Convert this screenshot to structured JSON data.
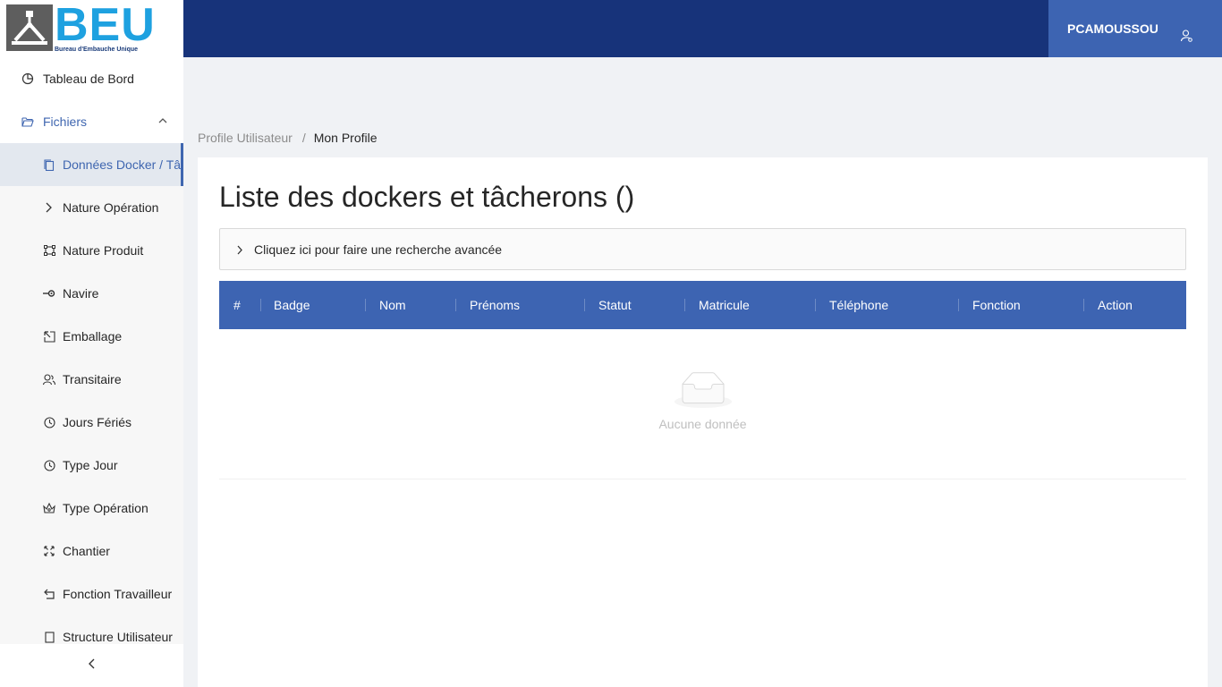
{
  "logo": {
    "big": "BEU",
    "small": "Bureau d'Embauche Unique"
  },
  "header": {
    "username": "PCAMOUSSOU"
  },
  "sidebar": {
    "dashboard": {
      "label": "Tableau de Bord",
      "icon": "pie-chart-icon"
    },
    "files": {
      "label": "Fichiers",
      "icon": "folder-open-icon"
    },
    "items": [
      {
        "label": "Données Docker / Tâcherons",
        "icon": "copy-icon"
      },
      {
        "label": "Nature Opération",
        "icon": "right-icon"
      },
      {
        "label": "Nature Produit",
        "icon": "border-icon"
      },
      {
        "label": "Navire",
        "icon": "ship-icon"
      },
      {
        "label": "Emballage",
        "icon": "select-icon"
      },
      {
        "label": "Transitaire",
        "icon": "users-icon"
      },
      {
        "label": "Jours Fériés",
        "icon": "clock-icon"
      },
      {
        "label": "Type Jour",
        "icon": "clock-icon"
      },
      {
        "label": "Type Opération",
        "icon": "crown-icon"
      },
      {
        "label": "Chantier",
        "icon": "expand-icon"
      },
      {
        "label": "Fonction Travailleur",
        "icon": "rollback-icon"
      },
      {
        "label": "Structure Utilisateur",
        "icon": "file-icon"
      }
    ],
    "collapse_icon": "chevron-left-icon"
  },
  "breadcrumb": {
    "parent": "Profile Utilisateur",
    "separator": "/",
    "current": "Mon Profile"
  },
  "main": {
    "title": "Liste des dockers et tâcherons ()",
    "search_toggle": "Cliquez ici pour faire une recherche avancée",
    "columns": [
      "#",
      "Badge",
      "Nom",
      "Prénoms",
      "Statut",
      "Matricule",
      "Téléphone",
      "Fonction",
      "Action"
    ],
    "empty_text": "Aucune donnée"
  },
  "colors": {
    "header": "#17337a",
    "accent": "#3d64b2",
    "logo": "#1ea1e0"
  }
}
